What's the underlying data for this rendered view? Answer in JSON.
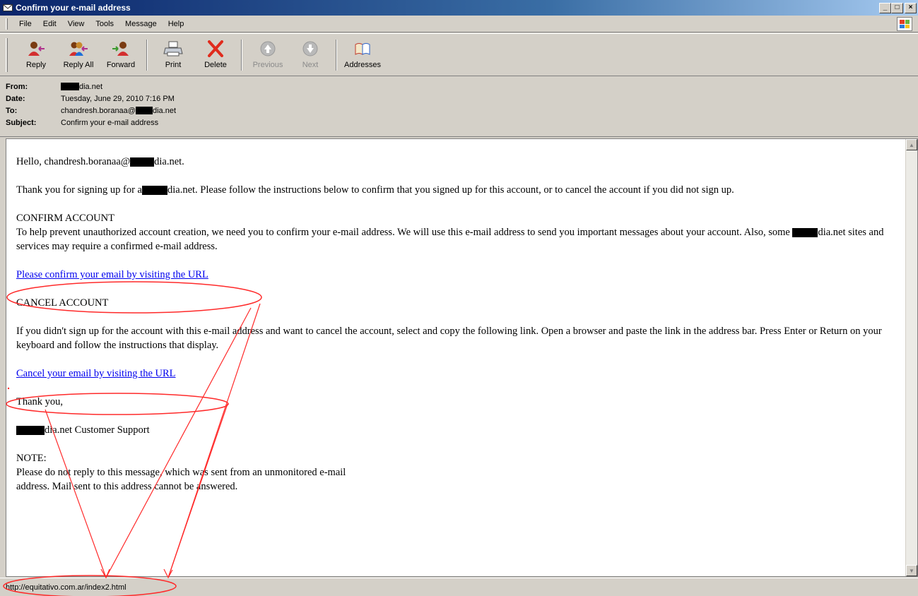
{
  "window": {
    "title": "Confirm your e-mail address",
    "controls": [
      "_",
      "□",
      "×"
    ]
  },
  "menu": [
    "File",
    "Edit",
    "View",
    "Tools",
    "Message",
    "Help"
  ],
  "toolbar": {
    "reply": "Reply",
    "reply_all": "Reply All",
    "forward": "Forward",
    "print": "Print",
    "delete": "Delete",
    "previous": "Previous",
    "next": "Next",
    "addresses": "Addresses"
  },
  "header": {
    "from_label": "From:",
    "from_value": "dia.net",
    "date_label": "Date:",
    "date_value": "Tuesday, June 29, 2010 7:16 PM",
    "to_label": "To:",
    "to_value_prefix": "chandresh.boranaa@",
    "to_value_suffix": "dia.net",
    "subject_label": "Subject:",
    "subject_value": "Confirm your e-mail address"
  },
  "body": {
    "greeting_prefix": "Hello, chandresh.boranaa@",
    "greeting_suffix": "dia.net.",
    "thanks_prefix": "Thank you for signing up for a",
    "thanks_suffix": "dia.net. Please follow the instructions below to confirm that you signed up for this account, or to cancel the account if you did not sign up.",
    "confirm_heading": "CONFIRM ACCOUNT",
    "confirm_text_prefix": "To help prevent unauthorized account creation, we need you to confirm your e-mail address. We will use this e-mail address to send you important messages about your account. Also, some ",
    "confirm_text_suffix": "dia.net sites and services may require a confirmed e-mail address.",
    "confirm_link": "Please confirm your email by visiting the URL",
    "cancel_heading": "CANCEL ACCOUNT",
    "cancel_text": "If you didn't sign up for the account with this e-mail address and want to cancel the account, select and copy the following link. Open a browser and paste the link in the address bar. Press Enter or Return on your keyboard and follow the instructions that display.",
    "cancel_link": "Cancel your email by visiting the URL",
    "thank_you": "Thank you,",
    "signature_suffix": "dia.net Customer Support",
    "note_heading": "NOTE:",
    "note_line1": "Please do not reply to this message, which was sent from an unmonitored e-mail",
    "note_line2": "address. Mail sent to this address cannot be answered."
  },
  "status": {
    "url": "http://equitativo.com.ar/index2.html"
  },
  "colors": {
    "annotation": "#ff2a2a",
    "link": "#0000ee"
  }
}
